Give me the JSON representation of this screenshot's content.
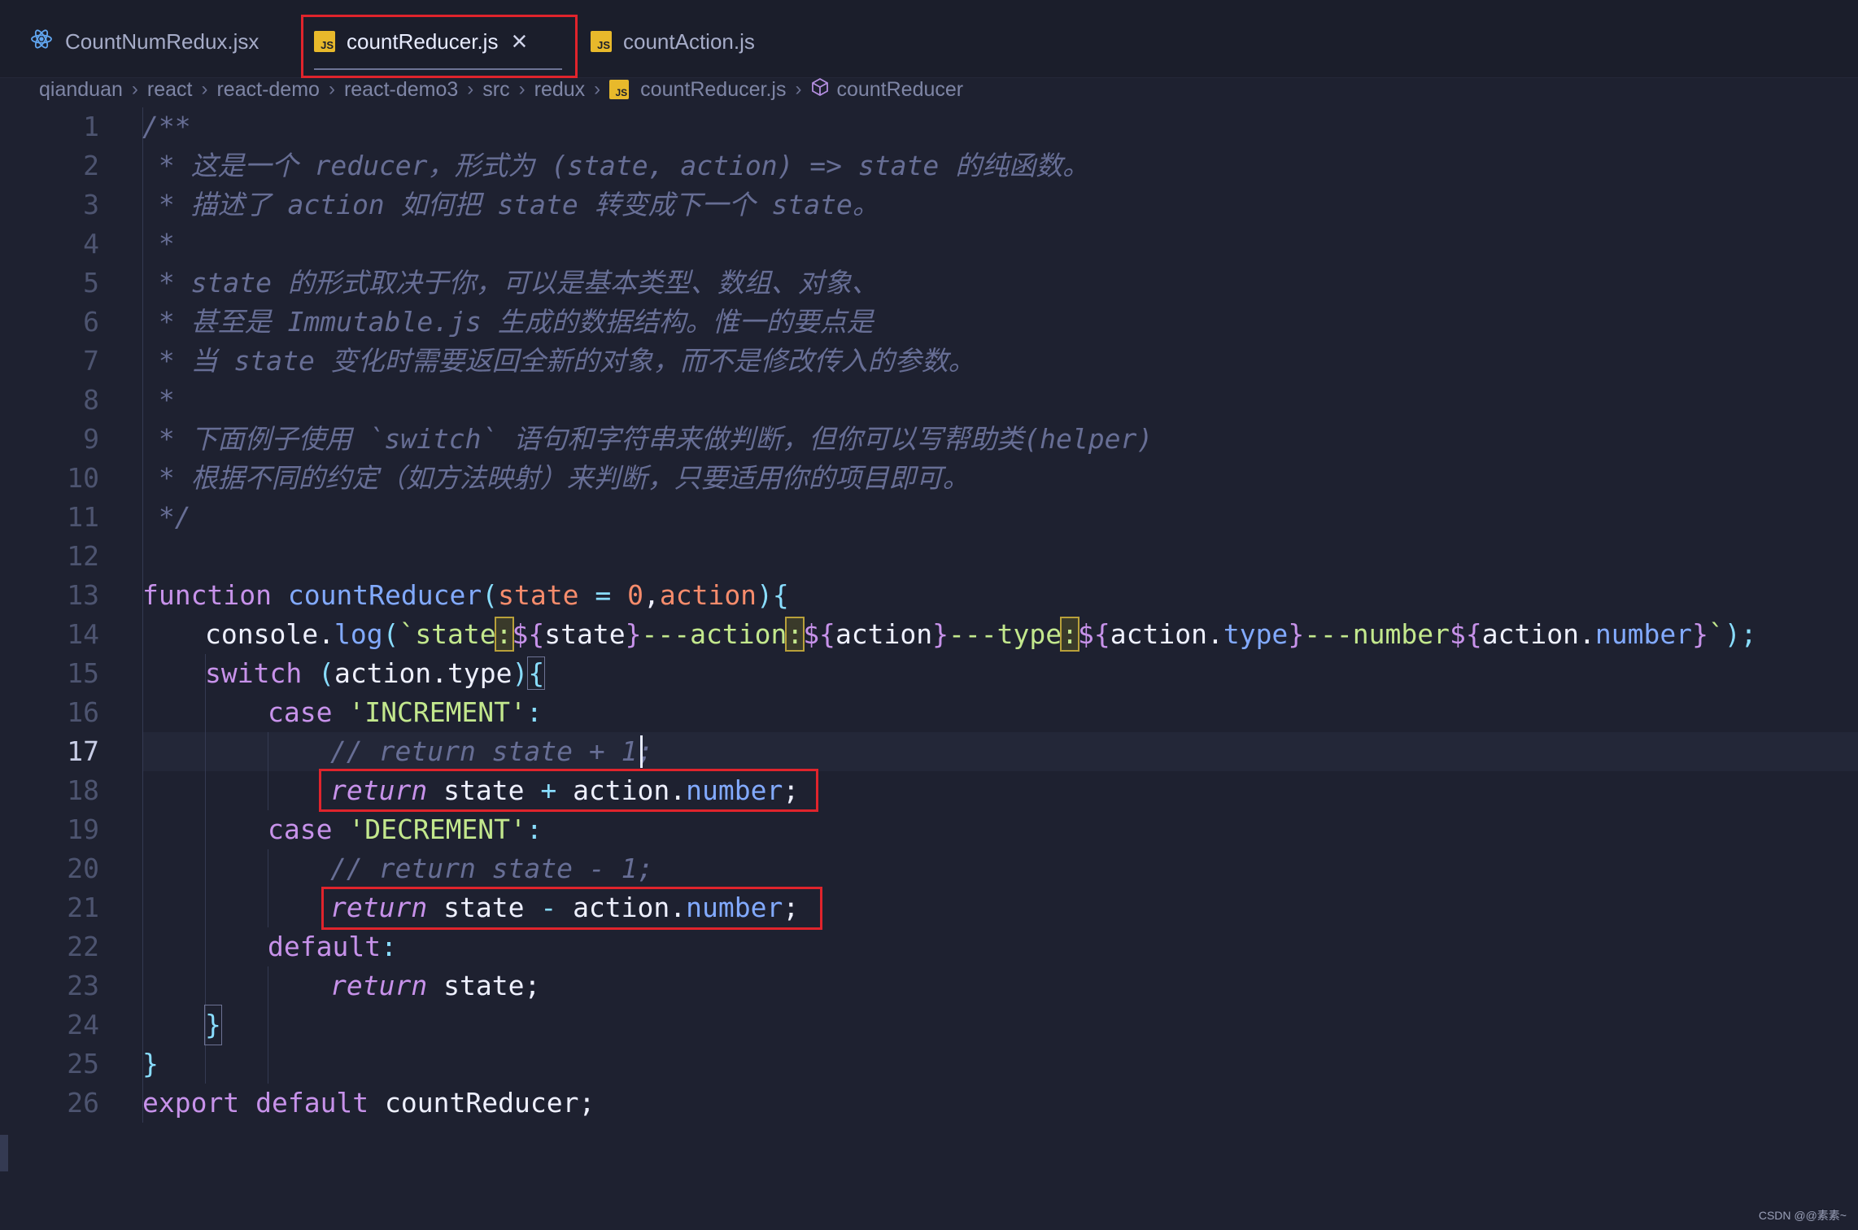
{
  "tabs": [
    {
      "label": "CountNumRedux.jsx",
      "icon": "react-icon"
    },
    {
      "label": "countReducer.js",
      "icon": "js-file-icon",
      "active": true
    },
    {
      "label": "countAction.js",
      "icon": "js-file-icon"
    }
  ],
  "breadcrumb": [
    "qianduan",
    "react",
    "react-demo",
    "react-demo3",
    "src",
    "redux",
    "countReducer.js",
    "countReducer"
  ],
  "line_numbers": [
    "1",
    "2",
    "3",
    "4",
    "5",
    "6",
    "7",
    "8",
    "9",
    "10",
    "11",
    "12",
    "13",
    "14",
    "15",
    "16",
    "17",
    "18",
    "19",
    "20",
    "21",
    "22",
    "23",
    "24",
    "25",
    "26"
  ],
  "code": {
    "l1": "/**",
    "l2": " * 这是一个 reducer，形式为 (state, action) => state 的纯函数。",
    "l3": " * 描述了 action 如何把 state 转变成下一个 state。",
    "l4": " *",
    "l5": " * state 的形式取决于你，可以是基本类型、数组、对象、",
    "l6": " * 甚至是 Immutable.js 生成的数据结构。惟一的要点是",
    "l7": " * 当 state 变化时需要返回全新的对象，而不是修改传入的参数。",
    "l8": " *",
    "l9": " * 下面例子使用 `switch` 语句和字符串来做判断，但你可以写帮助类(helper)",
    "l10": " * 根据不同的约定（如方法映射）来判断，只要适用你的项目即可。",
    "l11": " */",
    "l17": "// return state + 1;",
    "l20": "// return state - 1;"
  },
  "tokens": {
    "function": "function",
    "countReducer": "countReducer",
    "state": "state",
    "zero": "0",
    "action": "action",
    "console": "console",
    "log": "log",
    "switch": "switch",
    "type": "type",
    "number": "number",
    "case": "case",
    "increment": "'INCREMENT'",
    "decrement": "'DECREMENT'",
    "return": "return",
    "default": "default",
    "export": "export",
    "tpl_state": "state",
    "tpl_sep_action": "---action",
    "tpl_sep_type": "---type",
    "tpl_sep_number": "---number",
    "colon": ":",
    "dollar_open": "${",
    "close_brace": "}",
    "backtick": "`"
  },
  "watermark": "CSDN @@素素~",
  "current_line": 17
}
